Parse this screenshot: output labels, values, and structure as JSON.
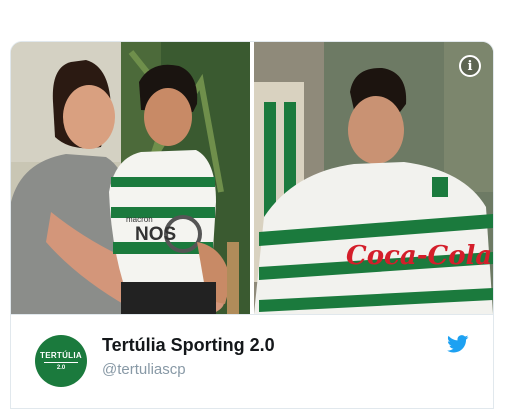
{
  "tweet": {
    "author": {
      "name": "Tertúlia Sporting 2.0",
      "handle": "@tertuliascp",
      "avatar_text": "TERTÚLIA",
      "avatar_subtext": "2.0"
    },
    "media": {
      "photo_left": {
        "jersey_text": "NOS",
        "jersey_sponsor": "macron"
      },
      "photo_right": {
        "jersey_text": "Coca-Cola"
      },
      "info_icon": "info-icon"
    },
    "icons": {
      "brand": "twitter-bird-icon"
    },
    "colors": {
      "sporting_green": "#1b7a3d",
      "twitter_blue": "#1da1f2",
      "handle_gray": "#8899a6"
    }
  }
}
